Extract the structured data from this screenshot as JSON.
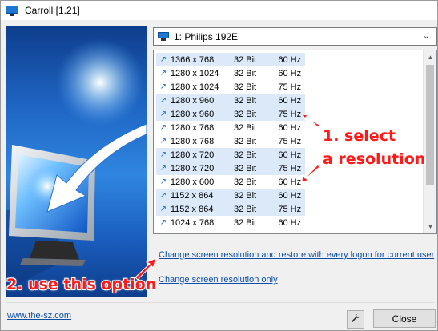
{
  "window": {
    "title": "Carroll [1.21]"
  },
  "monitor_select": {
    "value": "1: Philips 192E"
  },
  "resolutions": [
    {
      "res": "1366 x 768",
      "bits": "32 Bit",
      "hz": "60 Hz",
      "shaded": true
    },
    {
      "res": "1280 x 1024",
      "bits": "32 Bit",
      "hz": "60 Hz",
      "shaded": false
    },
    {
      "res": "1280 x 1024",
      "bits": "32 Bit",
      "hz": "75 Hz",
      "shaded": false
    },
    {
      "res": "1280 x 960",
      "bits": "32 Bit",
      "hz": "60 Hz",
      "shaded": true
    },
    {
      "res": "1280 x 960",
      "bits": "32 Bit",
      "hz": "75 Hz",
      "shaded": true
    },
    {
      "res": "1280 x 768",
      "bits": "32 Bit",
      "hz": "60 Hz",
      "shaded": false
    },
    {
      "res": "1280 x 768",
      "bits": "32 Bit",
      "hz": "75 Hz",
      "shaded": false
    },
    {
      "res": "1280 x 720",
      "bits": "32 Bit",
      "hz": "60 Hz",
      "shaded": true
    },
    {
      "res": "1280 x 720",
      "bits": "32 Bit",
      "hz": "75 Hz",
      "shaded": true
    },
    {
      "res": "1280 x 600",
      "bits": "32 Bit",
      "hz": "60 Hz",
      "shaded": false
    },
    {
      "res": "1152 x 864",
      "bits": "32 Bit",
      "hz": "60 Hz",
      "shaded": true
    },
    {
      "res": "1152 x 864",
      "bits": "32 Bit",
      "hz": "75 Hz",
      "shaded": true
    },
    {
      "res": "1024 x 768",
      "bits": "32 Bit",
      "hz": "60 Hz",
      "shaded": false
    }
  ],
  "links": {
    "restore_every_logon": "Change screen resolution and restore with every logon for current user",
    "only": "Change screen resolution only"
  },
  "annotations": {
    "step1_line1": "1. select",
    "step1_line2": "a resolution",
    "step2": "2. use this option"
  },
  "footer": {
    "website": "www.the-sz.com",
    "close_label": "Close"
  },
  "colors": {
    "annotation": "#ff1a1a",
    "link": "#0b4fa8",
    "row_shade": "#dbe9f9"
  }
}
